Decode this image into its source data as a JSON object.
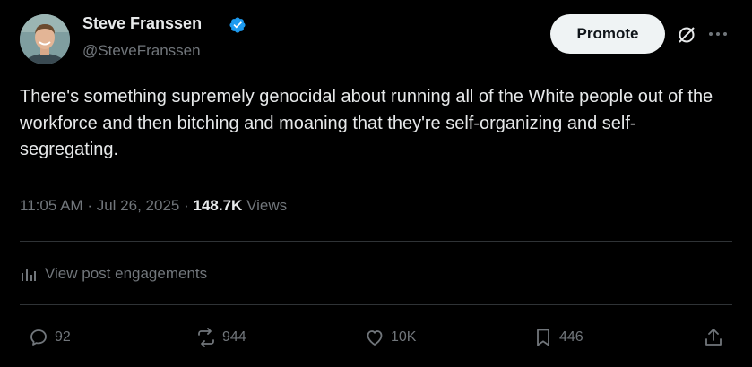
{
  "author": {
    "name": "Steve Franssen",
    "handle": "@SteveFranssen"
  },
  "promote_label": "Promote",
  "tweet": {
    "text": "There's something supremely genocidal about running all of the White people out of the workforce and then bitching and moaning that they're self-organizing and self-segregating.",
    "time": "11:05 AM",
    "date": "Jul 26, 2025",
    "separator": "·",
    "views_count": "148.7K",
    "views_label": "Views"
  },
  "engagements_label": "View post engagements",
  "actions": {
    "replies": "92",
    "reposts": "944",
    "likes": "10K",
    "bookmarks": "446"
  },
  "colors": {
    "background": "#000000",
    "text": "#e7e9ea",
    "secondary": "#71767b",
    "verified": "#1d9bf0",
    "divider": "#2f3336",
    "button_bg": "#eff3f4"
  },
  "icons": [
    "verified-badge-icon",
    "grok-icon",
    "more-icon",
    "engagements-icon",
    "reply-icon",
    "repost-icon",
    "like-icon",
    "bookmark-icon",
    "share-icon"
  ]
}
